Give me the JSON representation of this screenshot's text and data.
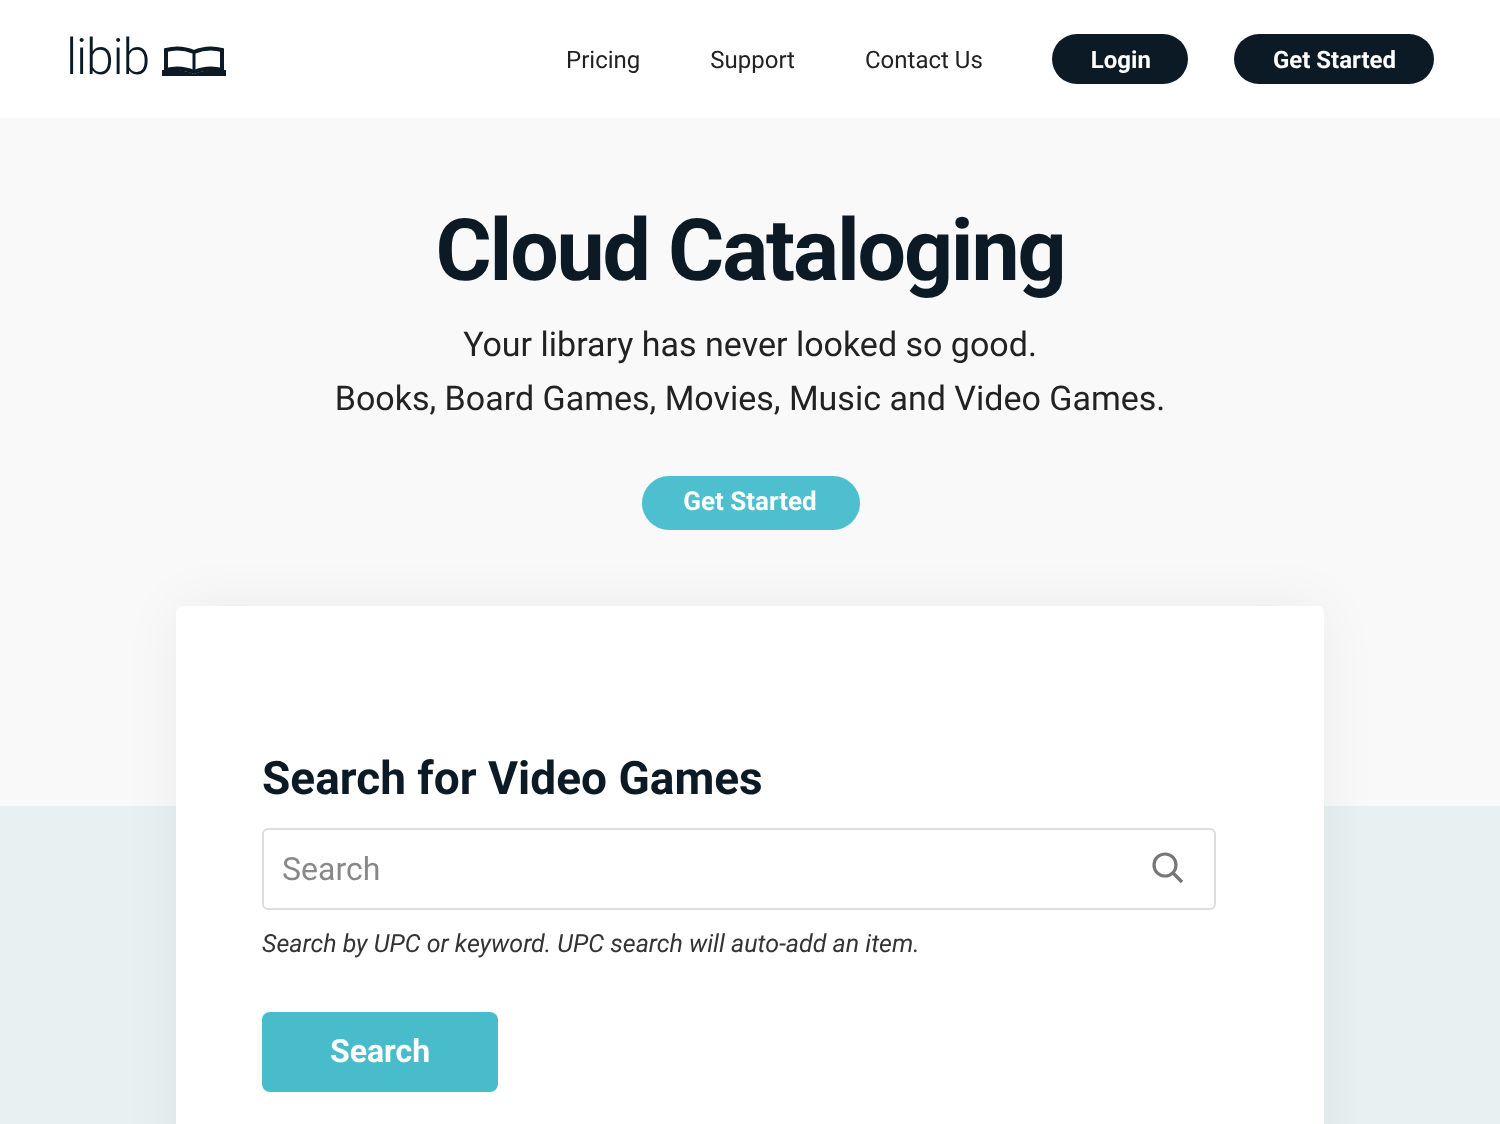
{
  "header": {
    "logo": "libib",
    "nav": [
      {
        "label": "Pricing",
        "kind": "link"
      },
      {
        "label": "Support",
        "kind": "link"
      },
      {
        "label": "Contact Us",
        "kind": "link"
      },
      {
        "label": "Login",
        "kind": "button"
      },
      {
        "label": "Get Started",
        "kind": "button"
      }
    ]
  },
  "hero": {
    "title": "Cloud Cataloging",
    "subtitle": [
      "Your library has never looked so good.",
      "Books, Board Games, Movies, Music and Video Games."
    ],
    "button": "Get Started"
  },
  "search_card": {
    "title": "Search for Video Games",
    "placeholder": "Search",
    "help": "Search by UPC or keyword. UPC search will auto-add an item.",
    "button": "Search"
  }
}
